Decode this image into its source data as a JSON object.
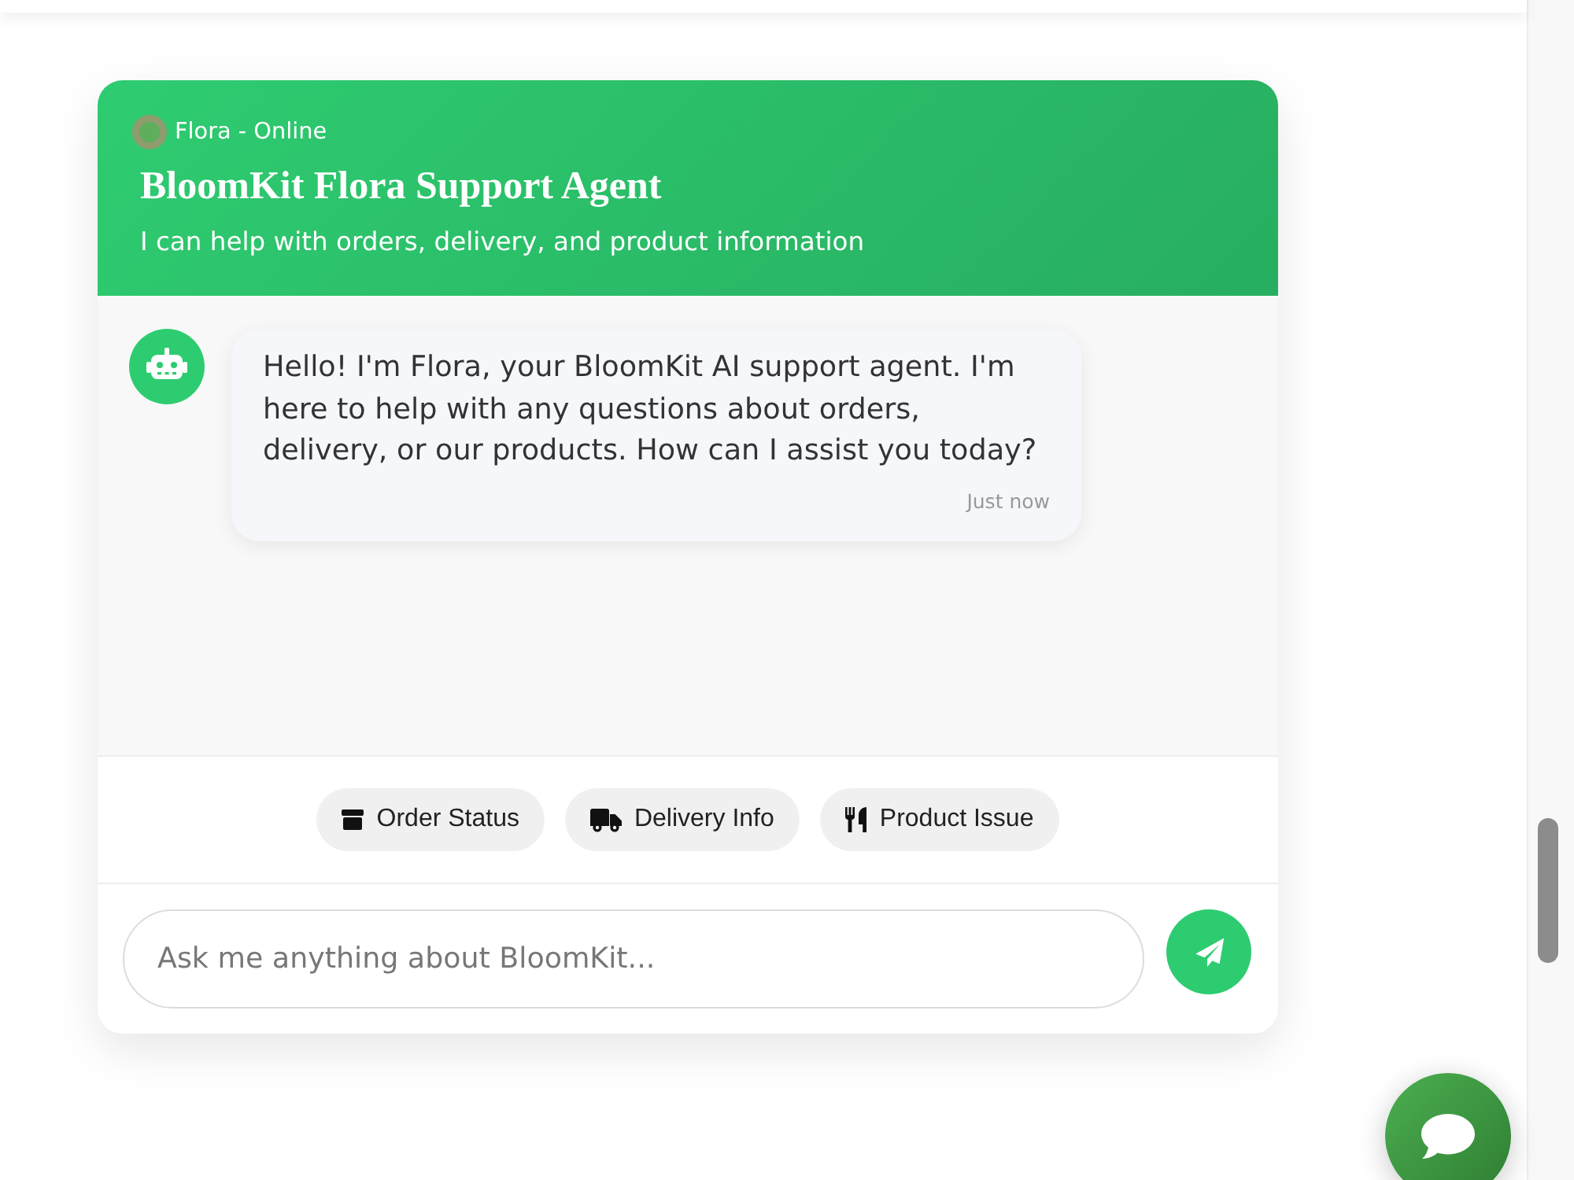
{
  "header": {
    "status": "Flora - Online",
    "title": "BloomKit Flora Support Agent",
    "subtitle": "I can help with orders, delivery, and product information"
  },
  "messages": [
    {
      "kind": "bot",
      "text": "Hello! I'm Flora, your BloomKit AI support agent. I'm here to help with any questions about orders, delivery, or our products. How can I assist you today?",
      "time": "Just now"
    }
  ],
  "quick_replies": [
    {
      "kind": "order",
      "label": "Order Status"
    },
    {
      "kind": "delivery",
      "label": "Delivery Info"
    },
    {
      "kind": "product",
      "label": "Product Issue"
    }
  ],
  "input": {
    "placeholder": "Ask me anything about BloomKit..."
  }
}
